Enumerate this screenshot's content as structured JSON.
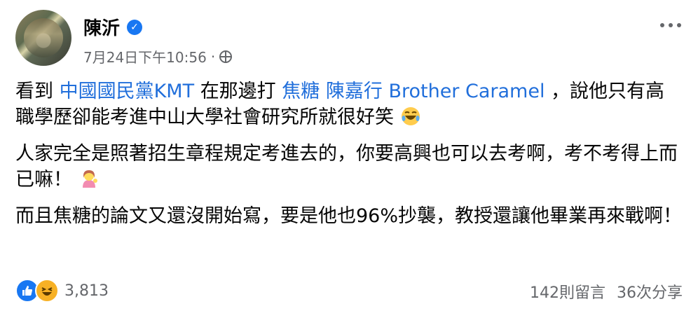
{
  "post": {
    "author": "陳沂",
    "timestamp": "7月24日下午10:56",
    "separator": "·",
    "paragraphs": [
      {
        "segments": [
          {
            "text": "看到 ",
            "link": false
          },
          {
            "text": "中國國民黨KMT",
            "link": true
          },
          {
            "text": "在那邊打 ",
            "link": false
          },
          {
            "text": "焦糖 陳嘉行 Brother Caramel",
            "link": true
          },
          {
            "text": "，說他只有高職學歷卻能考進中山大學社會研究所就很好笑",
            "link": false
          }
        ],
        "emoji": "rofl-emoji"
      },
      {
        "segments": [
          {
            "text": "人家完全是照著招生章程規定考進去的，你要高興也可以去考啊，考不考得上而已嘛！",
            "link": false
          }
        ],
        "emoji": "person-tipping-hand-emoji"
      },
      {
        "segments": [
          {
            "text": "而且焦糖的論文又還沒開始寫，要是他也96%抄襲，教授還讓他畢業再來戰啊！",
            "link": false
          }
        ],
        "emoji": null
      }
    ]
  },
  "footer": {
    "reaction_count": "3,813",
    "comments": "142則留言",
    "shares": "36次分享"
  },
  "colors": {
    "link": "#216fdb",
    "secondary_text": "#65676b",
    "verified": "#1877f2"
  }
}
